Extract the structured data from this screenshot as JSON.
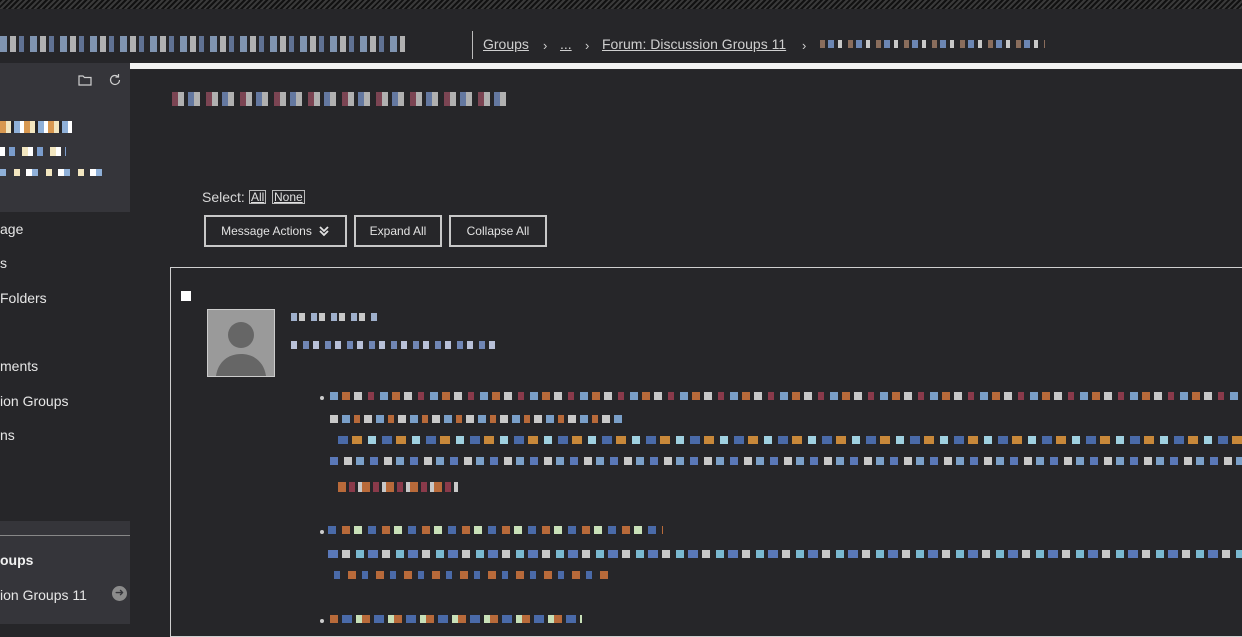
{
  "header": {
    "breadcrumbs": [
      {
        "label": "Groups"
      },
      {
        "label": "..."
      },
      {
        "label": "Forum: Discussion Groups 11"
      }
    ],
    "separator": "›"
  },
  "sidebar": {
    "nav_items": [
      {
        "label": "age"
      },
      {
        "label": "s"
      },
      {
        "label": "Folders"
      },
      {
        "label": "ments"
      },
      {
        "label": "ion Groups"
      },
      {
        "label": "ns"
      }
    ],
    "section_title": "oups",
    "section_item": "ion Groups 11"
  },
  "toolbar": {
    "select_label": "Select:",
    "select_all": "All",
    "select_none": "None",
    "message_actions": "Message Actions",
    "expand_all": "Expand All",
    "collapse_all": "Collapse All"
  },
  "icons": {
    "folder": "folder-icon",
    "refresh": "refresh-icon",
    "chevron": "double-chevron-down-icon",
    "arrow": "arrow-right-circle-icon"
  },
  "colors": {
    "background": "#262629",
    "panel": "#35353a",
    "text": "#d8d8d8",
    "border": "#c8c8c8"
  }
}
